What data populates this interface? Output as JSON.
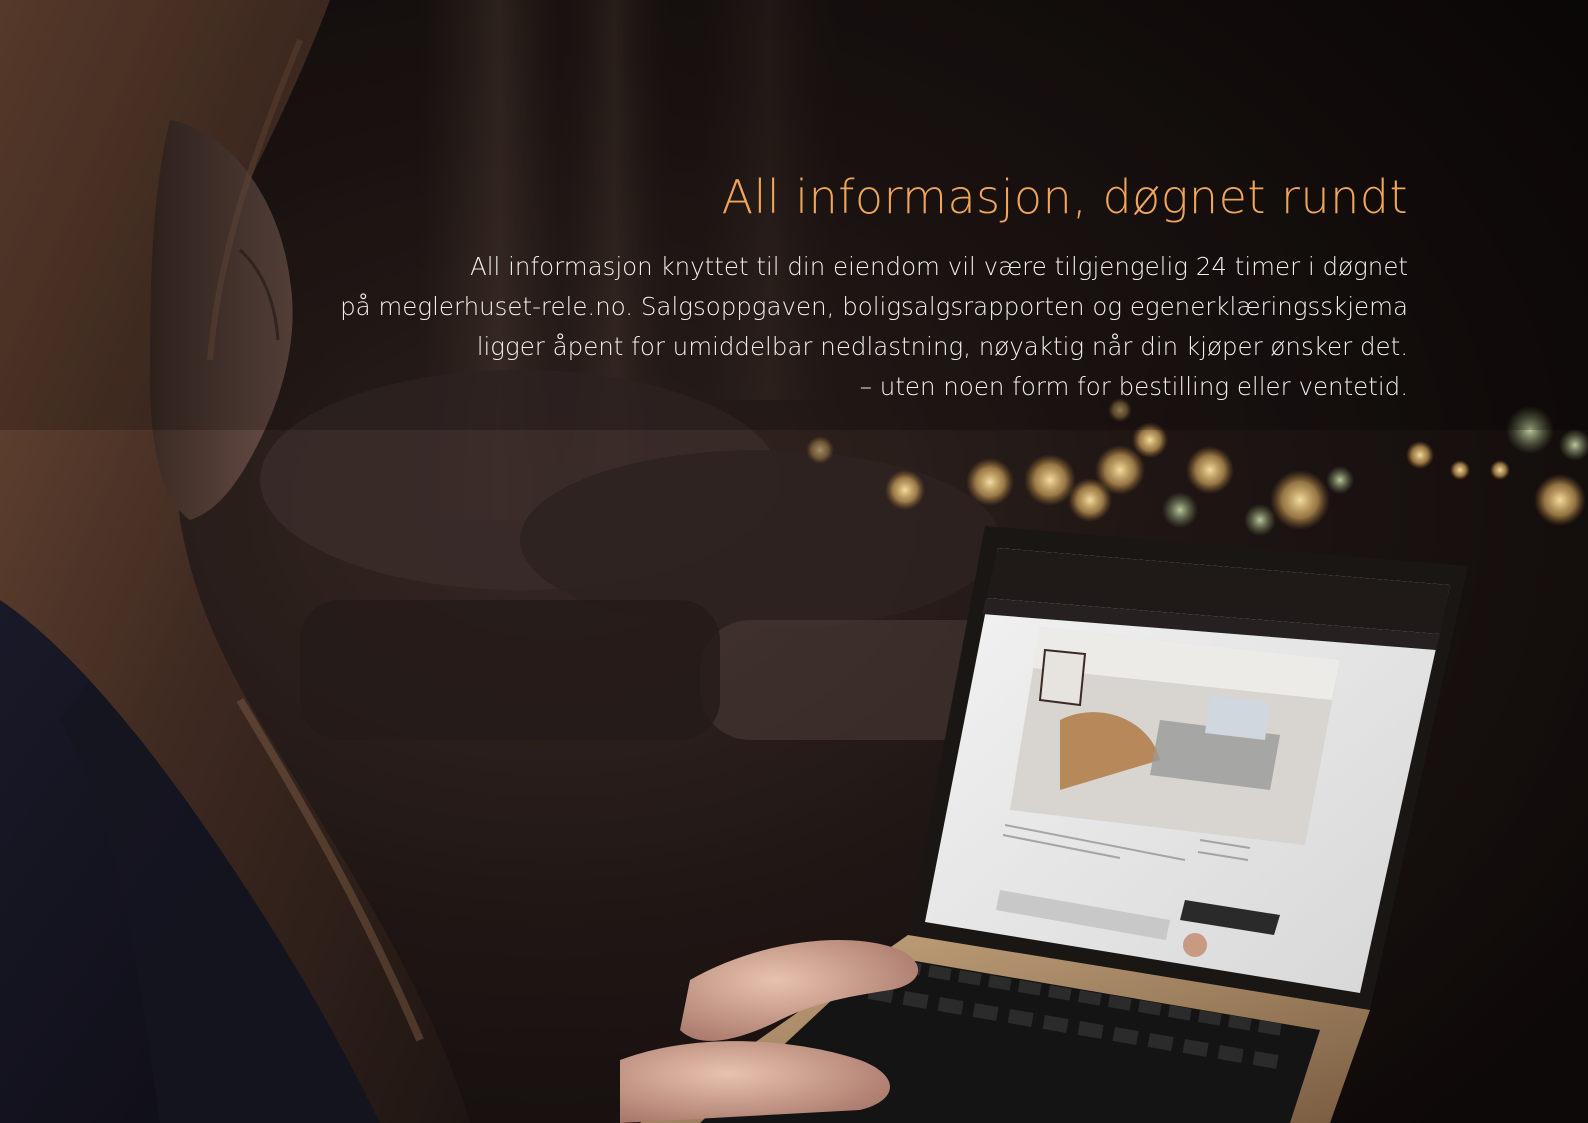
{
  "headline": "All informasjon, døgnet rundt",
  "body_lines": [
    "All informasjon knyttet til din eiendom vil være tilgjengelig 24 timer i døgnet",
    "på meglerhuset-rele.no. Salgsoppgaven, boligsalgsrapporten og egenerklæringsskjema",
    "ligger åpent for umiddelbar nedlastning, nøyaktig når din kjøper ønsker det.",
    "– uten noen form for bestilling eller ventetid."
  ],
  "colors": {
    "headline": "#f0a55a",
    "body": "#f2efec",
    "background": "#140e0c"
  }
}
